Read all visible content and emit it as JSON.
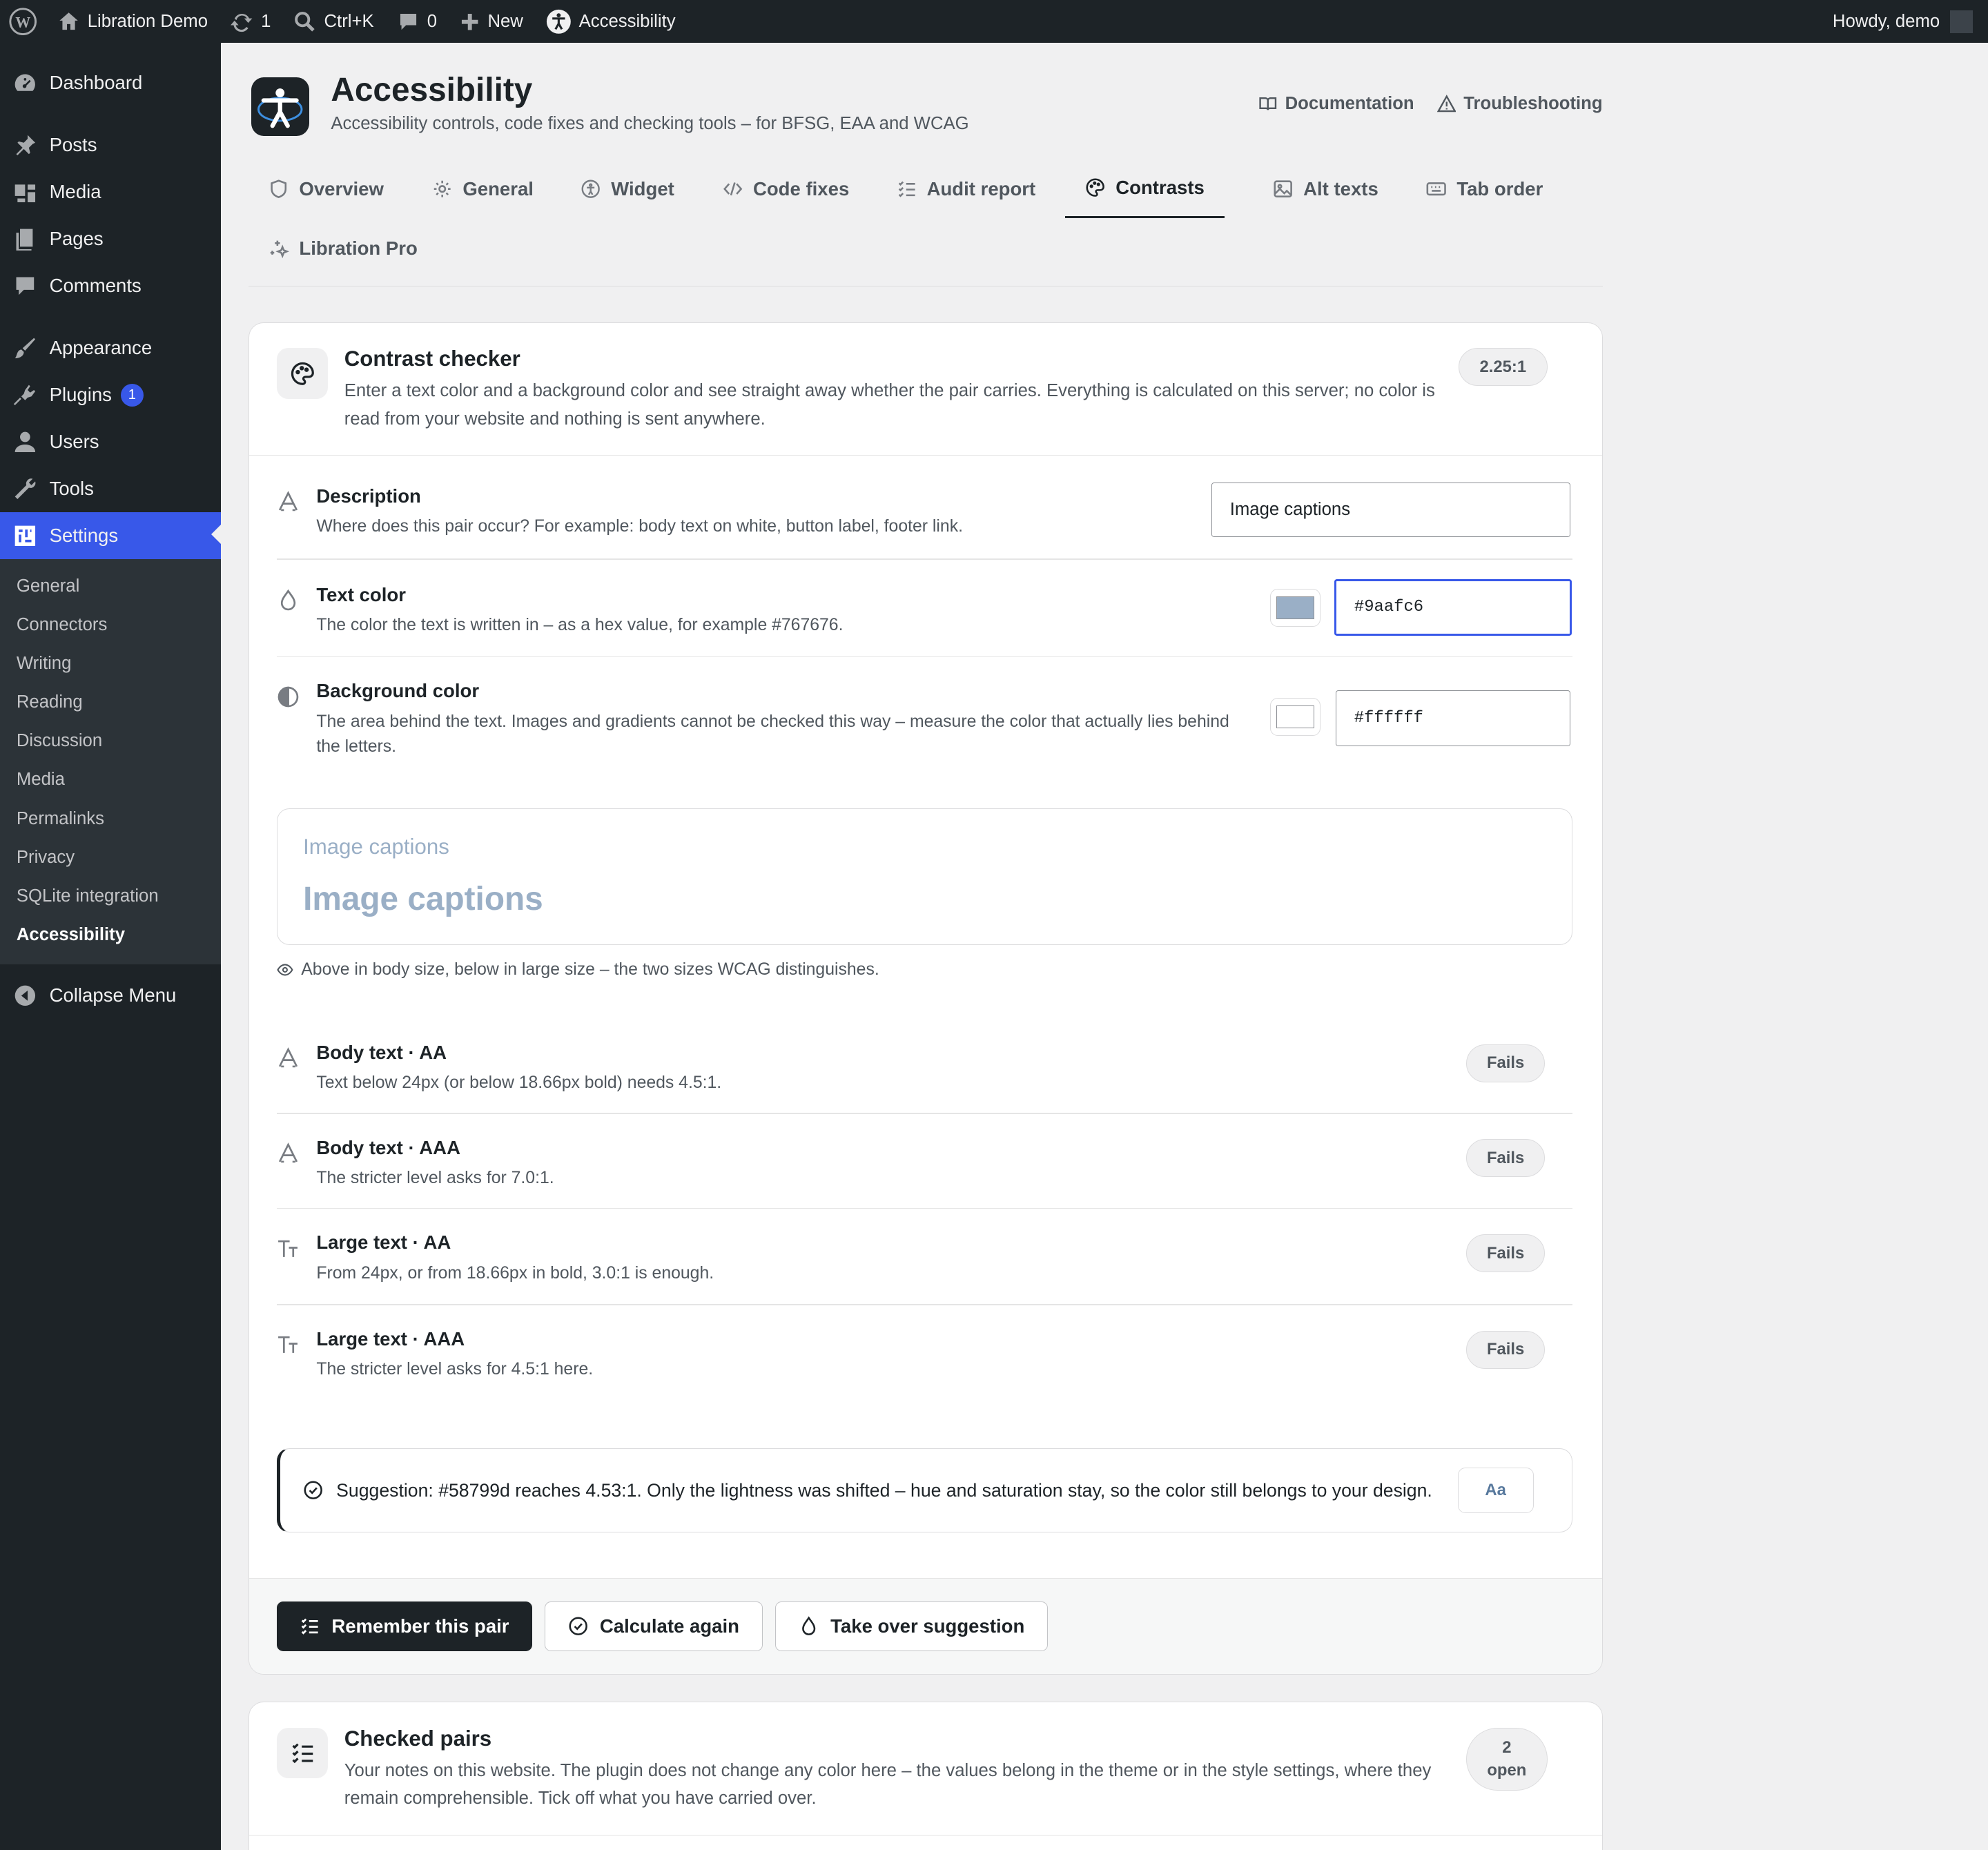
{
  "adminbar": {
    "site": "Libration Demo",
    "updates": "1",
    "search": "Ctrl+K",
    "comments": "0",
    "new": "New",
    "plugin": "Accessibility",
    "howdy": "Howdy, demo"
  },
  "sidebar": {
    "items": [
      {
        "label": "Dashboard",
        "icon": "dashboard-icon"
      },
      {
        "label": "Posts",
        "icon": "pin-icon"
      },
      {
        "label": "Media",
        "icon": "media-icon"
      },
      {
        "label": "Pages",
        "icon": "pages-icon"
      },
      {
        "label": "Comments",
        "icon": "comment-icon"
      },
      {
        "label": "Appearance",
        "icon": "brush-icon"
      },
      {
        "label": "Plugins",
        "icon": "plugin-icon",
        "badge": "1"
      },
      {
        "label": "Users",
        "icon": "user-icon"
      },
      {
        "label": "Tools",
        "icon": "wrench-icon"
      },
      {
        "label": "Settings",
        "icon": "settings-icon",
        "active": true
      }
    ],
    "submenu": [
      "General",
      "Connectors",
      "Writing",
      "Reading",
      "Discussion",
      "Media",
      "Permalinks",
      "Privacy",
      "SQLite integration",
      "Accessibility"
    ],
    "collapse": "Collapse Menu"
  },
  "header": {
    "title": "Accessibility",
    "subtitle": "Accessibility controls, code fixes and checking tools – for BFSG, EAA and WCAG",
    "documentation": "Documentation",
    "troubleshooting": "Troubleshooting"
  },
  "tabs": [
    "Overview",
    "General",
    "Widget",
    "Code fixes",
    "Audit report",
    "Contrasts",
    "Alt texts",
    "Tab order",
    "Libration Pro"
  ],
  "checker": {
    "title": "Contrast checker",
    "desc": "Enter a text color and a background color and see straight away whether the pair carries. Everything is calculated on this server; no color is read from your website and nothing is sent anywhere.",
    "ratio": "2.25:1",
    "description_label": "Description",
    "description_help": "Where does this pair occur? For example: body text on white, button label, footer link.",
    "description_value": "Image captions",
    "text_label": "Text color",
    "text_help": "The color the text is written in – as a hex value, for example #767676.",
    "text_value": "#9aafc6",
    "bg_label": "Background color",
    "bg_help": "The area behind the text. Images and gradients cannot be checked this way – measure the color that actually lies behind the letters.",
    "bg_value": "#ffffff",
    "preview_small": "Image captions",
    "preview_large": "Image captions",
    "preview_note": "Above in body size, below in large size – the two sizes WCAG distinguishes.",
    "results": [
      {
        "title": "Body text · AA",
        "desc": "Text below 24px (or below 18.66px bold) needs 4.5:1.",
        "status": "Fails"
      },
      {
        "title": "Body text · AAA",
        "desc": "The stricter level asks for 7.0:1.",
        "status": "Fails"
      },
      {
        "title": "Large text · AA",
        "desc": "From 24px, or from 18.66px in bold, 3.0:1 is enough.",
        "status": "Fails"
      },
      {
        "title": "Large text · AAA",
        "desc": "The stricter level asks for 4.5:1 here.",
        "status": "Fails"
      }
    ],
    "suggestion": "Suggestion: #58799d reaches 4.53:1. Only the lightness was shifted – hue and saturation stay, so the color still belongs to your design.",
    "suggestion_sample": "Aa",
    "btn_remember": "Remember this pair",
    "btn_calculate": "Calculate again",
    "btn_takeover": "Take over suggestion"
  },
  "checked": {
    "title": "Checked pairs",
    "desc": "Your notes on this website. The plugin does not change any color here – the values belong in the theme or in the style settings, where they remain comprehensible. Tick off what you have carried over.",
    "count": "2",
    "count_label": "open"
  },
  "colors": {
    "text_color": "#9aafc6",
    "bg_color": "#ffffff",
    "suggestion_color": "#58799d",
    "accent": "#3858e9"
  }
}
